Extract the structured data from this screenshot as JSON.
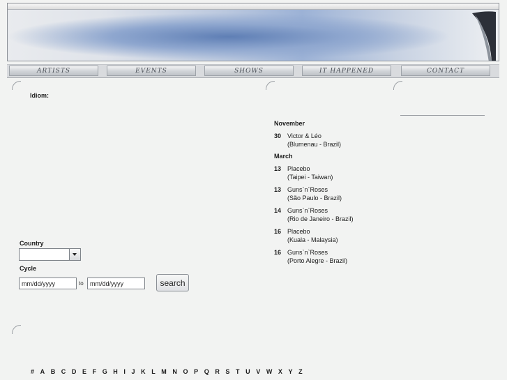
{
  "nav": {
    "items": [
      "ARTISTS",
      "EVENTS",
      "SHOWS",
      "IT HAPPENED",
      "CONTACT"
    ]
  },
  "idiom_label": "Idiom:",
  "events": [
    {
      "month": "November",
      "items": [
        {
          "day": "30",
          "artist": "Victor & Léo",
          "place": "(Blumenau - Brazil)"
        }
      ]
    },
    {
      "month": "March",
      "items": [
        {
          "day": "13",
          "artist": "Placebo",
          "place": "(Taipei - Taiwan)"
        },
        {
          "day": "13",
          "artist": "Guns`n`Roses",
          "place": "(São Paulo - Brazil)"
        },
        {
          "day": "14",
          "artist": "Guns`n`Roses",
          "place": "(Rio de Janeiro - Brazil)"
        },
        {
          "day": "16",
          "artist": "Placebo",
          "place": "(Kuala - Malaysia)"
        },
        {
          "day": "16",
          "artist": "Guns`n`Roses",
          "place": "(Porto Alegre - Brazil)"
        }
      ]
    }
  ],
  "search_form": {
    "country_label": "Country",
    "country_value": "",
    "cycle_label": "Cycle",
    "from_value": "mm/dd/yyyy",
    "to_text": "to",
    "to_value": "mm/dd/yyyy",
    "search_label": "search"
  },
  "alphabet": [
    "#",
    "A",
    "B",
    "C",
    "D",
    "E",
    "F",
    "G",
    "H",
    "I",
    "J",
    "K",
    "L",
    "M",
    "N",
    "O",
    "P",
    "Q",
    "R",
    "S",
    "T",
    "U",
    "V",
    "W",
    "X",
    "Y",
    "Z"
  ]
}
